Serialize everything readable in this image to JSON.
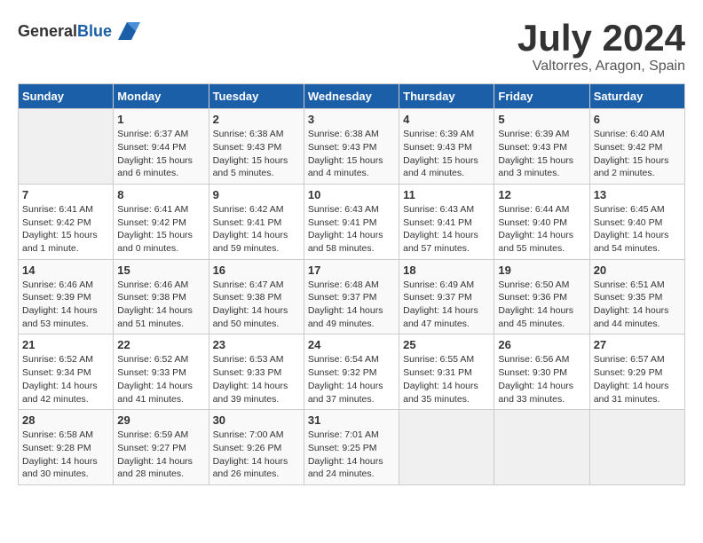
{
  "header": {
    "logo_general": "General",
    "logo_blue": "Blue",
    "title": "July 2024",
    "subtitle": "Valtorres, Aragon, Spain"
  },
  "days_of_week": [
    "Sunday",
    "Monday",
    "Tuesday",
    "Wednesday",
    "Thursday",
    "Friday",
    "Saturday"
  ],
  "weeks": [
    [
      {
        "day": "",
        "info": ""
      },
      {
        "day": "1",
        "info": "Sunrise: 6:37 AM\nSunset: 9:44 PM\nDaylight: 15 hours\nand 6 minutes."
      },
      {
        "day": "2",
        "info": "Sunrise: 6:38 AM\nSunset: 9:43 PM\nDaylight: 15 hours\nand 5 minutes."
      },
      {
        "day": "3",
        "info": "Sunrise: 6:38 AM\nSunset: 9:43 PM\nDaylight: 15 hours\nand 4 minutes."
      },
      {
        "day": "4",
        "info": "Sunrise: 6:39 AM\nSunset: 9:43 PM\nDaylight: 15 hours\nand 4 minutes."
      },
      {
        "day": "5",
        "info": "Sunrise: 6:39 AM\nSunset: 9:43 PM\nDaylight: 15 hours\nand 3 minutes."
      },
      {
        "day": "6",
        "info": "Sunrise: 6:40 AM\nSunset: 9:42 PM\nDaylight: 15 hours\nand 2 minutes."
      }
    ],
    [
      {
        "day": "7",
        "info": "Sunrise: 6:41 AM\nSunset: 9:42 PM\nDaylight: 15 hours\nand 1 minute."
      },
      {
        "day": "8",
        "info": "Sunrise: 6:41 AM\nSunset: 9:42 PM\nDaylight: 15 hours\nand 0 minutes."
      },
      {
        "day": "9",
        "info": "Sunrise: 6:42 AM\nSunset: 9:41 PM\nDaylight: 14 hours\nand 59 minutes."
      },
      {
        "day": "10",
        "info": "Sunrise: 6:43 AM\nSunset: 9:41 PM\nDaylight: 14 hours\nand 58 minutes."
      },
      {
        "day": "11",
        "info": "Sunrise: 6:43 AM\nSunset: 9:41 PM\nDaylight: 14 hours\nand 57 minutes."
      },
      {
        "day": "12",
        "info": "Sunrise: 6:44 AM\nSunset: 9:40 PM\nDaylight: 14 hours\nand 55 minutes."
      },
      {
        "day": "13",
        "info": "Sunrise: 6:45 AM\nSunset: 9:40 PM\nDaylight: 14 hours\nand 54 minutes."
      }
    ],
    [
      {
        "day": "14",
        "info": "Sunrise: 6:46 AM\nSunset: 9:39 PM\nDaylight: 14 hours\nand 53 minutes."
      },
      {
        "day": "15",
        "info": "Sunrise: 6:46 AM\nSunset: 9:38 PM\nDaylight: 14 hours\nand 51 minutes."
      },
      {
        "day": "16",
        "info": "Sunrise: 6:47 AM\nSunset: 9:38 PM\nDaylight: 14 hours\nand 50 minutes."
      },
      {
        "day": "17",
        "info": "Sunrise: 6:48 AM\nSunset: 9:37 PM\nDaylight: 14 hours\nand 49 minutes."
      },
      {
        "day": "18",
        "info": "Sunrise: 6:49 AM\nSunset: 9:37 PM\nDaylight: 14 hours\nand 47 minutes."
      },
      {
        "day": "19",
        "info": "Sunrise: 6:50 AM\nSunset: 9:36 PM\nDaylight: 14 hours\nand 45 minutes."
      },
      {
        "day": "20",
        "info": "Sunrise: 6:51 AM\nSunset: 9:35 PM\nDaylight: 14 hours\nand 44 minutes."
      }
    ],
    [
      {
        "day": "21",
        "info": "Sunrise: 6:52 AM\nSunset: 9:34 PM\nDaylight: 14 hours\nand 42 minutes."
      },
      {
        "day": "22",
        "info": "Sunrise: 6:52 AM\nSunset: 9:33 PM\nDaylight: 14 hours\nand 41 minutes."
      },
      {
        "day": "23",
        "info": "Sunrise: 6:53 AM\nSunset: 9:33 PM\nDaylight: 14 hours\nand 39 minutes."
      },
      {
        "day": "24",
        "info": "Sunrise: 6:54 AM\nSunset: 9:32 PM\nDaylight: 14 hours\nand 37 minutes."
      },
      {
        "day": "25",
        "info": "Sunrise: 6:55 AM\nSunset: 9:31 PM\nDaylight: 14 hours\nand 35 minutes."
      },
      {
        "day": "26",
        "info": "Sunrise: 6:56 AM\nSunset: 9:30 PM\nDaylight: 14 hours\nand 33 minutes."
      },
      {
        "day": "27",
        "info": "Sunrise: 6:57 AM\nSunset: 9:29 PM\nDaylight: 14 hours\nand 31 minutes."
      }
    ],
    [
      {
        "day": "28",
        "info": "Sunrise: 6:58 AM\nSunset: 9:28 PM\nDaylight: 14 hours\nand 30 minutes."
      },
      {
        "day": "29",
        "info": "Sunrise: 6:59 AM\nSunset: 9:27 PM\nDaylight: 14 hours\nand 28 minutes."
      },
      {
        "day": "30",
        "info": "Sunrise: 7:00 AM\nSunset: 9:26 PM\nDaylight: 14 hours\nand 26 minutes."
      },
      {
        "day": "31",
        "info": "Sunrise: 7:01 AM\nSunset: 9:25 PM\nDaylight: 14 hours\nand 24 minutes."
      },
      {
        "day": "",
        "info": ""
      },
      {
        "day": "",
        "info": ""
      },
      {
        "day": "",
        "info": ""
      }
    ]
  ]
}
